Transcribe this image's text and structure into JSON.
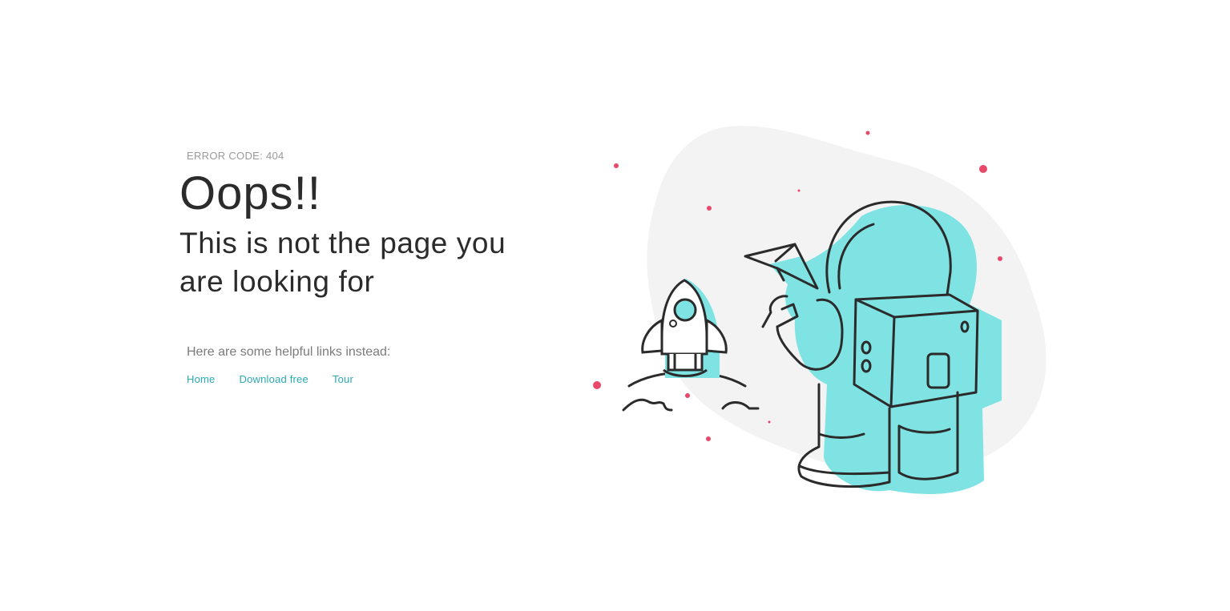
{
  "error": {
    "code_label": "ERROR CODE: 404"
  },
  "headline": "Oops!!",
  "subheadline": "This is not the page you are looking for",
  "helper_text": "Here are some helpful links instead:",
  "links": [
    {
      "label": "Home"
    },
    {
      "label": "Download free"
    },
    {
      "label": "Tour"
    }
  ],
  "colors": {
    "accent": "#2aa9b5",
    "illustration_fill": "#7fe3e3",
    "star": "#e8486a",
    "blob": "#f3f3f3",
    "outline": "#2b2b2b"
  },
  "illustration": {
    "subject": "astronaut-with-paper-plane-and-rocket"
  }
}
